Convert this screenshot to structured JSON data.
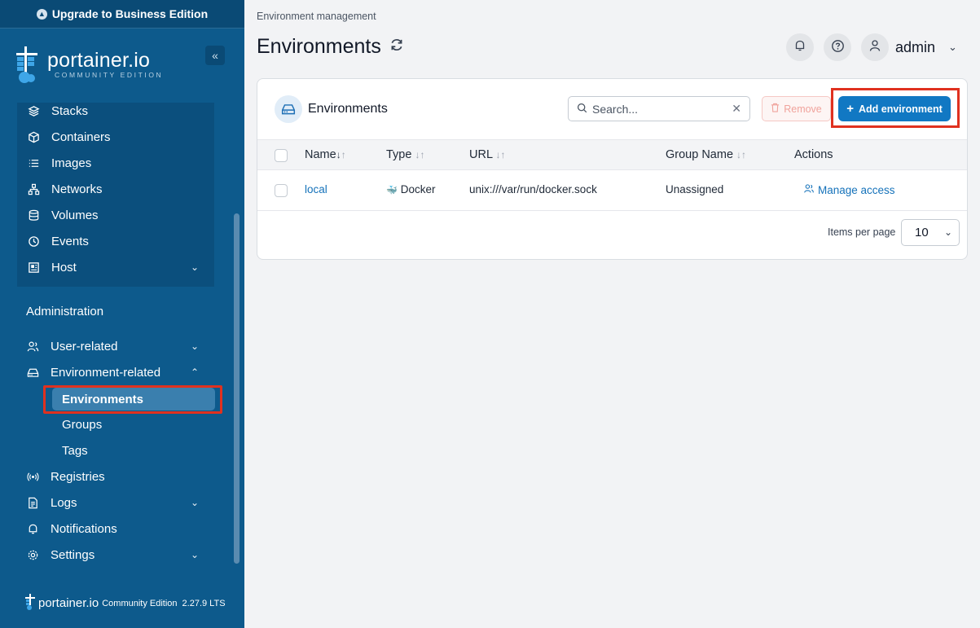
{
  "sidebar": {
    "upgrade_label": "Upgrade to Business Edition",
    "logo_name": "portainer.io",
    "logo_sub": "COMMUNITY EDITION",
    "env_items": [
      {
        "label": "Stacks",
        "icon": "stacks-icon"
      },
      {
        "label": "Containers",
        "icon": "container-icon"
      },
      {
        "label": "Images",
        "icon": "images-icon"
      },
      {
        "label": "Networks",
        "icon": "network-icon"
      },
      {
        "label": "Volumes",
        "icon": "volume-icon"
      },
      {
        "label": "Events",
        "icon": "clock-icon"
      },
      {
        "label": "Host",
        "icon": "host-icon"
      }
    ],
    "admin_title": "Administration",
    "admin_items": {
      "user_related": "User-related",
      "environment_related": "Environment-related",
      "environments": "Environments",
      "groups": "Groups",
      "tags": "Tags",
      "registries": "Registries",
      "logs": "Logs",
      "notifications": "Notifications",
      "settings": "Settings"
    },
    "footer": {
      "name": "portainer.io",
      "edition": "Community Edition",
      "version": "2.27.9 LTS"
    }
  },
  "header": {
    "breadcrumb": "Environment management",
    "title": "Environments",
    "user": "admin"
  },
  "card": {
    "title": "Environments",
    "search_placeholder": "Search...",
    "remove_label": "Remove",
    "add_label": "Add environment",
    "columns": [
      "Name",
      "Type",
      "URL",
      "Group Name",
      "Actions"
    ],
    "rows": [
      {
        "name": "local",
        "type": "Docker",
        "url": "unix:///var/run/docker.sock",
        "group": "Unassigned",
        "action": "Manage access"
      }
    ],
    "items_per_page_label": "Items per page",
    "items_per_page_value": "10"
  },
  "colors": {
    "sidebar_bg": "#0d5a8c",
    "accent": "#1178c3",
    "highlight": "#e0311f"
  }
}
